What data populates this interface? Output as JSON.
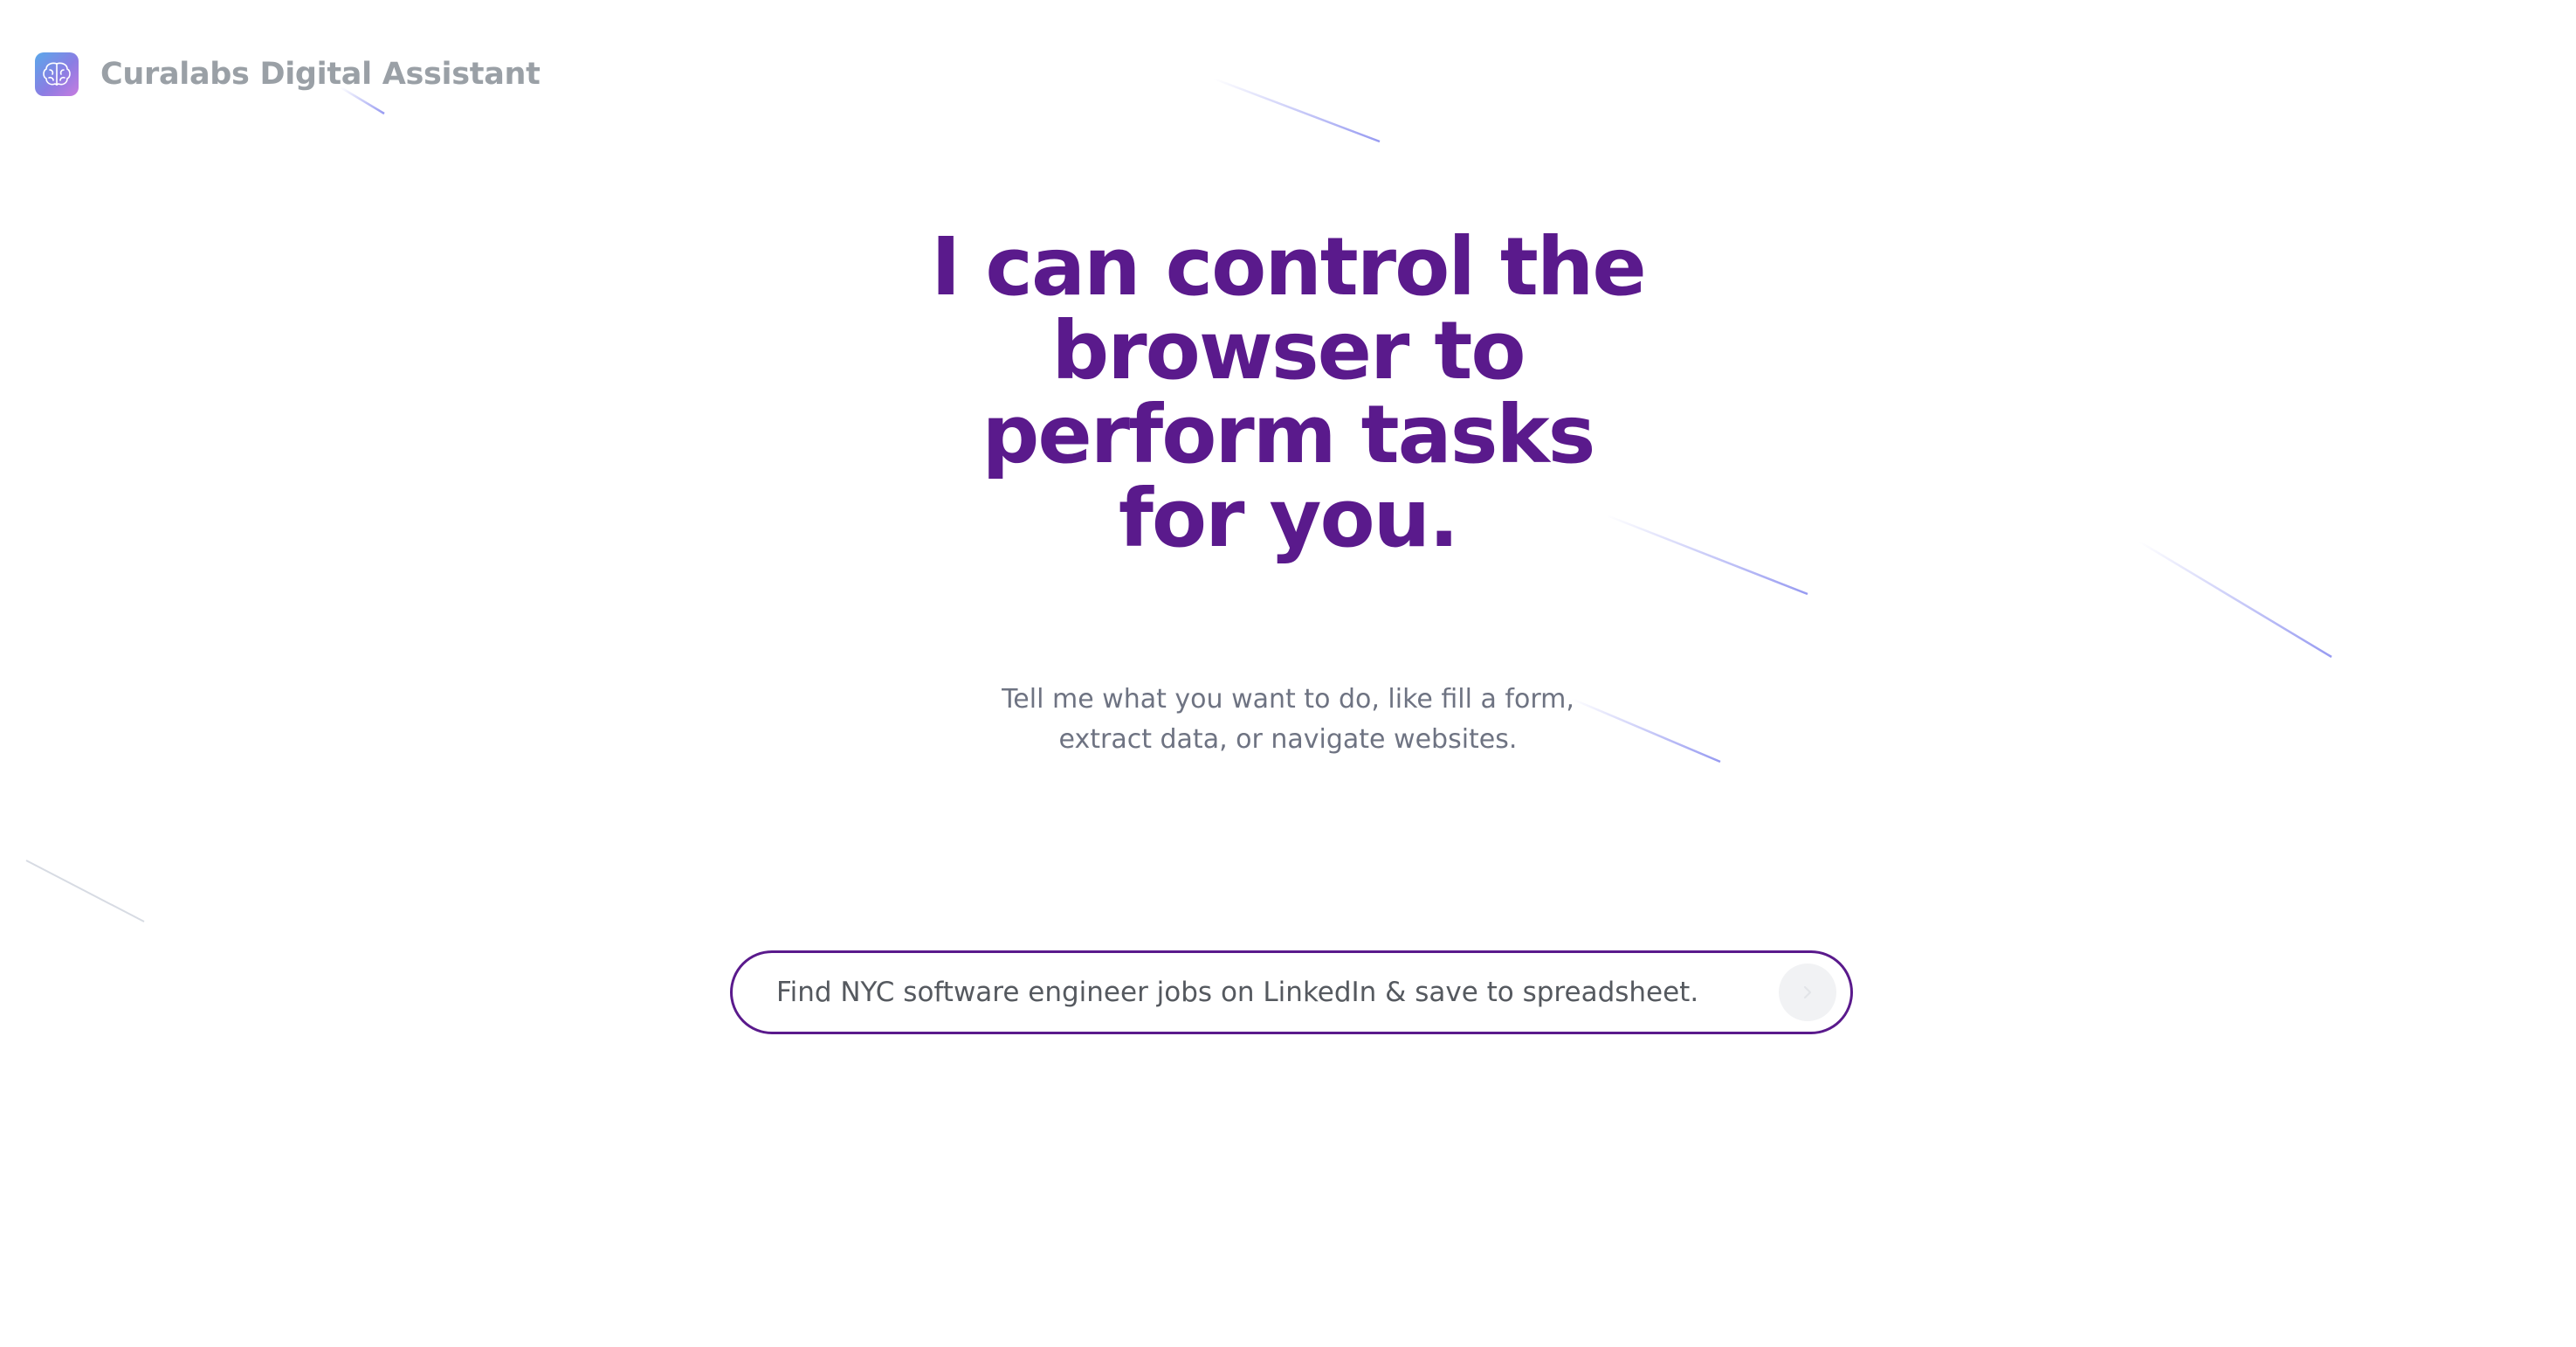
{
  "brand": {
    "name": "Curalabs Digital Assistant",
    "logo_icon": "brain-icon"
  },
  "hero": {
    "title_lines": [
      "I can control the",
      "browser to",
      "perform tasks",
      "for you."
    ],
    "subtitle_lines": [
      "Tell me what you want to do, like fill a form,",
      "extract data, or navigate websites."
    ]
  },
  "prompt": {
    "placeholder": "Find NYC software engineer jobs on LinkedIn & save to spreadsheet.",
    "value": "",
    "send_icon": "arrow-right-icon"
  },
  "colors": {
    "accent": "#5a1a8c",
    "muted_text": "#6e7382",
    "brand_text": "#9aa0a6",
    "streak": "#8b8ff0"
  }
}
